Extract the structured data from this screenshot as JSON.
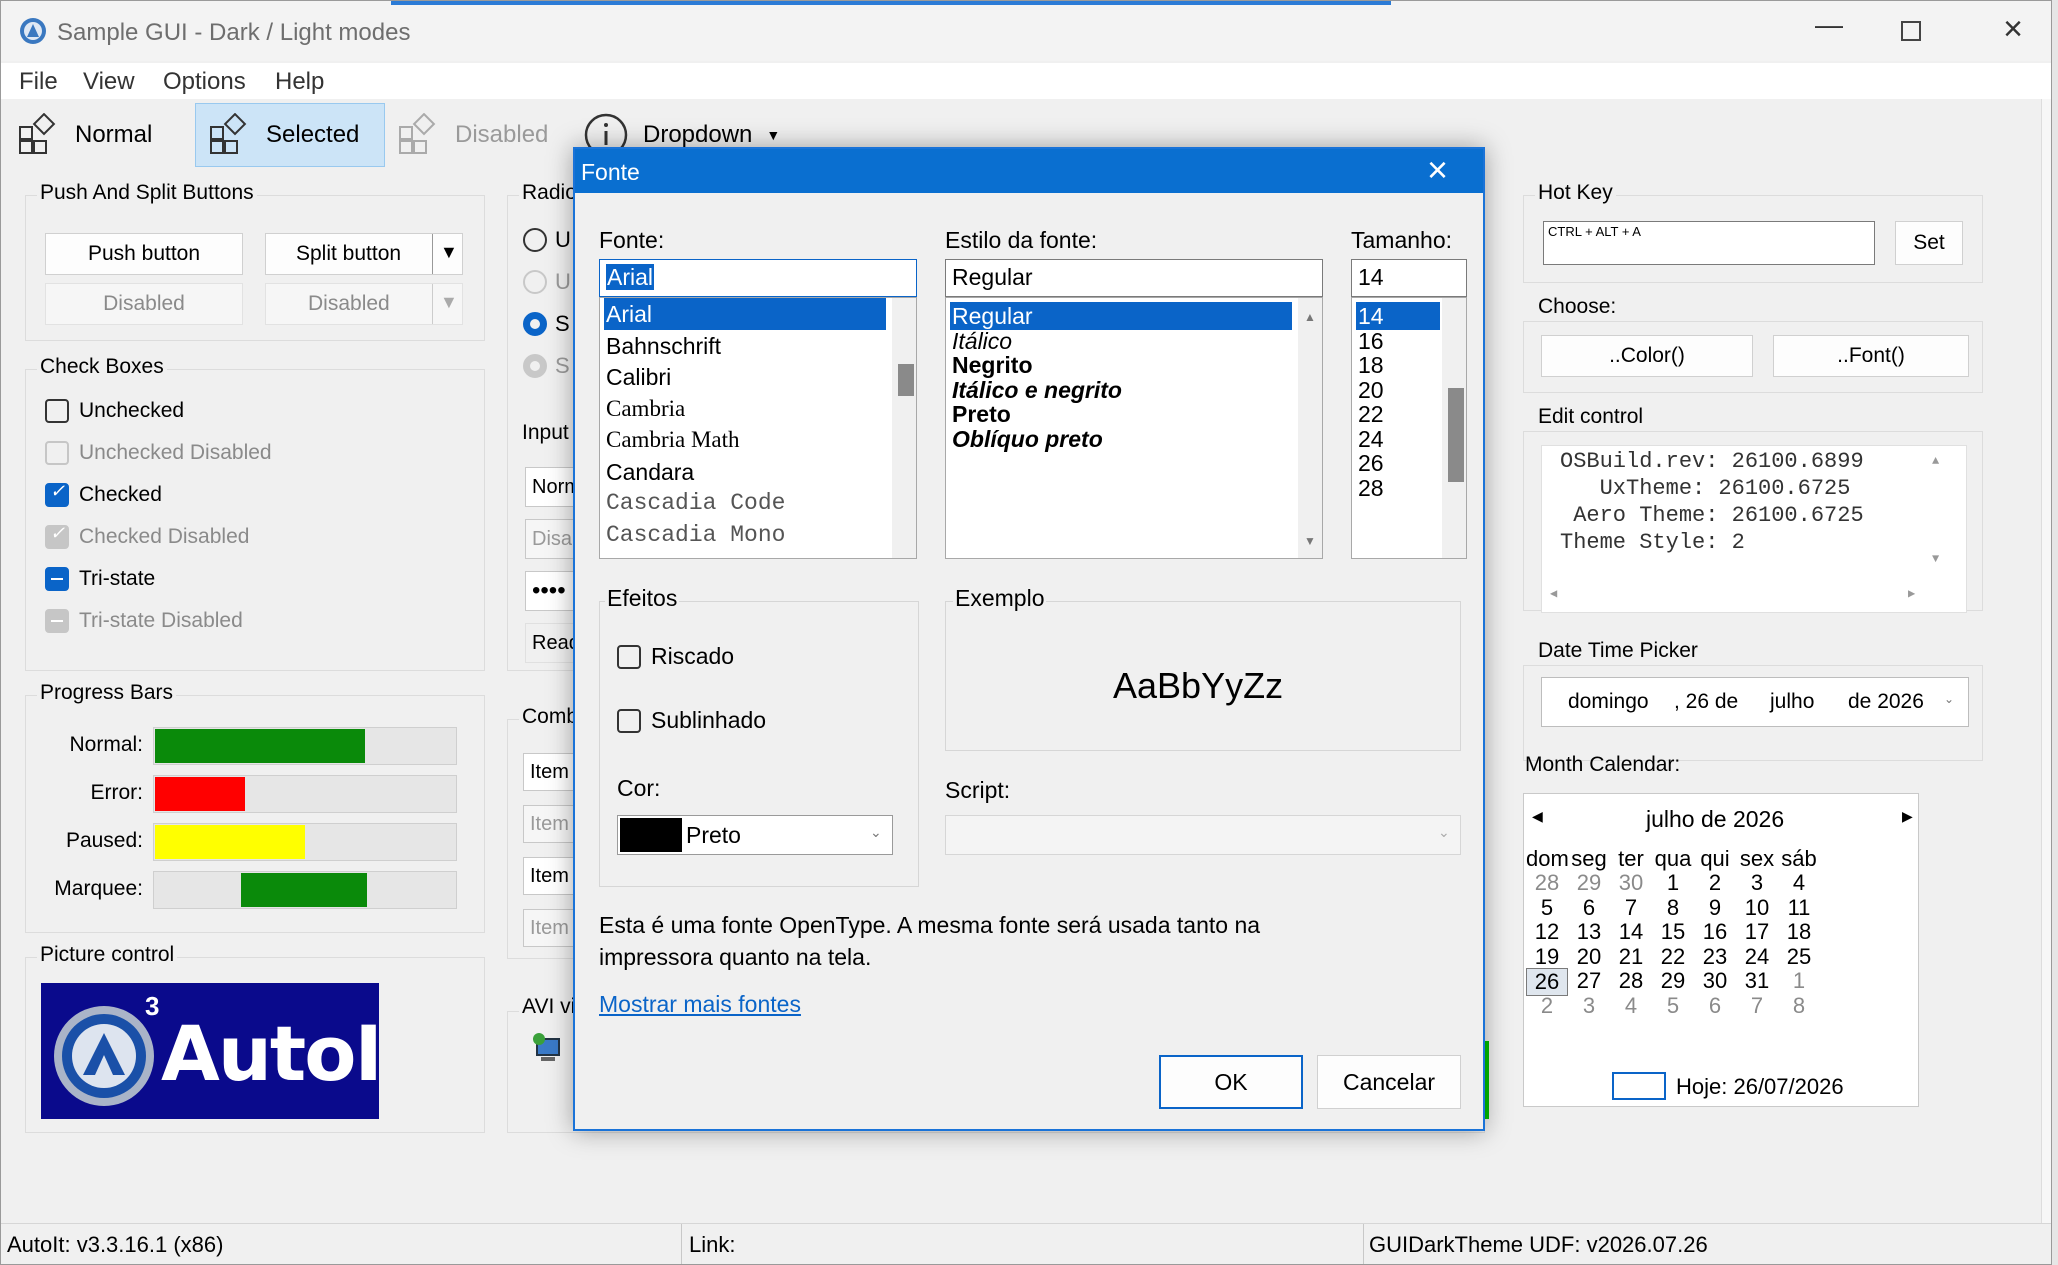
{
  "window": {
    "title": "Sample GUI - Dark / Light modes"
  },
  "menu": [
    "File",
    "View",
    "Options",
    "Help"
  ],
  "toolbar": {
    "normal": "Normal",
    "selected": "Selected",
    "disabled": "Disabled",
    "dropdown": "Dropdown"
  },
  "push_split": {
    "title": "Push And Split Buttons",
    "push_button": "Push button",
    "split_button": "Split button",
    "push_disabled": "Disabled",
    "split_disabled": "Disabled"
  },
  "checkboxes": {
    "title": "Check Boxes",
    "items": [
      {
        "label": "Unchecked",
        "state": "unchecked",
        "disabled": false
      },
      {
        "label": "Unchecked Disabled",
        "state": "unchecked",
        "disabled": true
      },
      {
        "label": "Checked",
        "state": "checked",
        "disabled": false
      },
      {
        "label": "Checked Disabled",
        "state": "checked",
        "disabled": true
      },
      {
        "label": "Tri-state",
        "state": "indeterminate",
        "disabled": false
      },
      {
        "label": "Tri-state Disabled",
        "state": "indeterminate",
        "disabled": true
      }
    ]
  },
  "progress": {
    "title": "Progress Bars",
    "bars": [
      {
        "label": "Normal:",
        "value": 0.7,
        "color": "#0a8a0a"
      },
      {
        "label": "Error:",
        "value": 0.3,
        "color": "#ff0000"
      },
      {
        "label": "Paused:",
        "value": 0.5,
        "color": "#ffff00"
      },
      {
        "label": "Marquee:",
        "value": 0.41,
        "color": "#0a8a0a"
      }
    ]
  },
  "picture": {
    "title": "Picture control",
    "logo_text": "AutoIt",
    "logo_sup": "3"
  },
  "radio": {
    "title": "Radio",
    "items": [
      "U",
      "U",
      "S",
      "S"
    ]
  },
  "input": {
    "title": "Input",
    "items": [
      "Norm",
      "Disa",
      "••••",
      "Read"
    ]
  },
  "combo": {
    "title": "Comb",
    "items": [
      "Item",
      "Item",
      "Item",
      "Item"
    ]
  },
  "avi": {
    "title": "AVI vi"
  },
  "hotkey": {
    "title": "Hot Key",
    "value": "CTRL + ALT + A",
    "set": "Set"
  },
  "choose": {
    "title": "Choose:",
    "color": "..Color()",
    "font": "..Font()"
  },
  "edit": {
    "title": "Edit control",
    "lines": [
      "OSBuild.rev: 26100.6899",
      "   UxTheme: 26100.6725",
      " Aero Theme: 26100.6725",
      "Theme Style: 2"
    ]
  },
  "datetime": {
    "title": "Date Time Picker",
    "day": "domingo",
    "date": ", 26 de",
    "month": "julho",
    "year": "de 2026"
  },
  "calendar": {
    "title": "Month Calendar:",
    "header": "julho de 2026",
    "weekdays": [
      "dom",
      "seg",
      "ter",
      "qua",
      "qui",
      "sex",
      "sáb"
    ],
    "weeks": [
      [
        "28",
        "29",
        "30",
        "1",
        "2",
        "3",
        "4"
      ],
      [
        "5",
        "6",
        "7",
        "8",
        "9",
        "10",
        "11"
      ],
      [
        "12",
        "13",
        "14",
        "15",
        "16",
        "17",
        "18"
      ],
      [
        "19",
        "20",
        "21",
        "22",
        "23",
        "24",
        "25"
      ],
      [
        "26",
        "27",
        "28",
        "29",
        "30",
        "31",
        "1"
      ],
      [
        "2",
        "3",
        "4",
        "5",
        "6",
        "7",
        "8"
      ]
    ],
    "selected": "26",
    "today": "Hoje: 26/07/2026"
  },
  "status": {
    "left": "AutoIt:  v3.3.16.1 (x86)",
    "middle": "Link:",
    "right": "GUIDarkTheme UDF:  v2026.07.26"
  },
  "font_dialog": {
    "title": "Fonte",
    "font_label": "Fonte:",
    "font_value": "Arial",
    "fonts": [
      "Arial",
      "Bahnschrift",
      "Calibri",
      "Cambria",
      "Cambria Math",
      "Candara",
      "Cascadia Code",
      "Cascadia Mono"
    ],
    "style_label": "Estilo da fonte:",
    "style_value": "Regular",
    "styles": [
      "Regular",
      "Itálico",
      "Negrito",
      "Itálico e negrito",
      "Preto",
      "Oblíquo preto"
    ],
    "size_label": "Tamanho:",
    "size_value": "14",
    "sizes": [
      "14",
      "16",
      "18",
      "20",
      "22",
      "24",
      "26",
      "28"
    ],
    "effects_label": "Efeitos",
    "strike": "Riscado",
    "underline": "Sublinhado",
    "color_label": "Cor:",
    "color_value": "Preto",
    "sample_label": "Exemplo",
    "sample_text": "AaBbYyZz",
    "script_label": "Script:",
    "info": "Esta é uma fonte OpenType. A mesma fonte será usada tanto na impressora quanto na tela.",
    "more_link": "Mostrar mais fontes",
    "ok": "OK",
    "cancel": "Cancelar"
  }
}
